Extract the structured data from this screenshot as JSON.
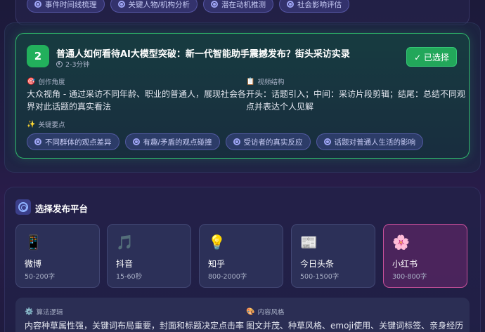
{
  "prev_tags": [
    "事件时间线梳理",
    "关键人物/机构分析",
    "潜在动机推测",
    "社会影响评估"
  ],
  "option": {
    "number": "2",
    "title": "普通人如何看待AI大模型突破：新一代智能助手震撼发布？街头采访实录",
    "duration": "2-3分钟",
    "select_label": "✓ 已选择",
    "angle": {
      "icon": "🎯",
      "label": "创作角度",
      "text_line1": "大众视角 - 通过采访不同年龄、职业的普通人，展现社会各",
      "text_line2": "界对此话题的真实看法"
    },
    "structure": {
      "icon": "📋",
      "label": "视频结构",
      "text_line1": "开头：话题引入；中间：采访片段剪辑；结尾：总结不同观",
      "text_line2": "点并表达个人见解"
    },
    "keypoints": {
      "icon": "✨",
      "label": "关键要点",
      "tags": [
        "不同群体的观点差异",
        "有趣/矛盾的观点碰撞",
        "受访者的真实反应",
        "话题对普通人生活的影响"
      ]
    }
  },
  "platforms": {
    "title": "选择发布平台",
    "items": [
      {
        "icon": "📱",
        "name": "微博",
        "range": "50-200字",
        "active": false
      },
      {
        "icon": "🎵",
        "name": "抖音",
        "range": "15-60秒",
        "active": false
      },
      {
        "icon": "💡",
        "name": "知乎",
        "range": "800-2000字",
        "active": false
      },
      {
        "icon": "📰",
        "name": "今日头条",
        "range": "500-1500字",
        "active": false
      },
      {
        "icon": "🌸",
        "name": "小红书",
        "range": "300-800字",
        "active": true
      }
    ]
  },
  "info": {
    "algo": {
      "icon": "⚙️",
      "label": "算法逻辑",
      "text": "内容种草属性强，关键词布局重要，封面和标题决定点击率"
    },
    "style": {
      "icon": "🎨",
      "label": "内容风格",
      "text": "图文并茂、种草风格、emoji使用、关键词标签、亲身经历"
    }
  },
  "colors": {
    "accent_green": "#22b05c",
    "active_pink": "#c8509a",
    "tag_purple": "#9fa5f5"
  }
}
